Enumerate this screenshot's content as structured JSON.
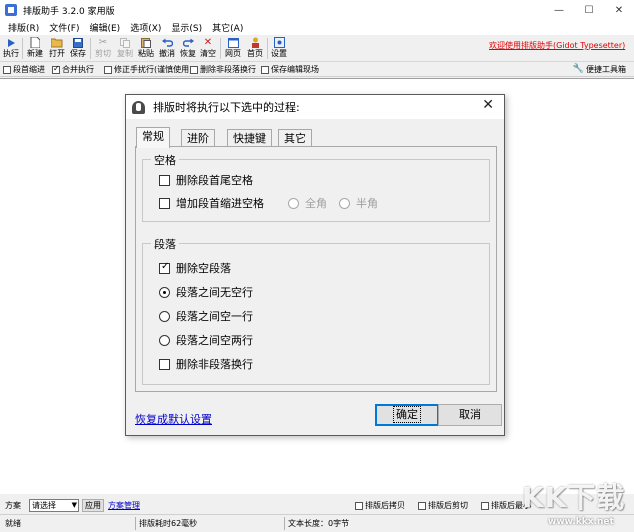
{
  "window": {
    "title": "排版助手 3.2.0 家用版",
    "minimize": "—",
    "maximize": "☐",
    "close": "✕"
  },
  "menu": [
    "排版(R)",
    "文件(F)",
    "编辑(E)",
    "选项(X)",
    "显示(S)",
    "其它(A)"
  ],
  "toolbar": {
    "buttons": [
      {
        "label": "执行",
        "icon": "play-icon"
      },
      {
        "label": "新建",
        "icon": "new-file-icon"
      },
      {
        "label": "打开",
        "icon": "open-folder-icon"
      },
      {
        "label": "保存",
        "icon": "save-icon"
      },
      {
        "label": "剪切",
        "icon": "cut-icon"
      },
      {
        "label": "复制",
        "icon": "copy-icon"
      },
      {
        "label": "粘贴",
        "icon": "paste-icon"
      },
      {
        "label": "撤消",
        "icon": "undo-icon"
      },
      {
        "label": "恢复",
        "icon": "redo-icon"
      },
      {
        "label": "清空",
        "icon": "clear-icon"
      },
      {
        "label": "网页",
        "icon": "webpage-icon"
      },
      {
        "label": "首页",
        "icon": "home-icon"
      },
      {
        "label": "设置",
        "icon": "settings-icon"
      }
    ],
    "welcome": "欢迎使用排版助手(Gidot Typesetter)"
  },
  "options": [
    {
      "label": "段首缩进",
      "checked": false
    },
    {
      "label": "合并执行",
      "checked": true
    },
    {
      "label": "修正手扰行(谨慎使用)",
      "checked": false
    },
    {
      "label": "删除非段落换行",
      "checked": false
    },
    {
      "label": "保存编辑现场",
      "checked": false
    }
  ],
  "quick_toolbox": "便捷工具箱",
  "scheme": {
    "label": "方案",
    "selected": "请选择",
    "apply": "应用",
    "manage": "方案管理",
    "post_options": [
      "排版后拷贝",
      "排版后剪切",
      "排版后最小"
    ]
  },
  "status": {
    "left": "就绪",
    "elapsed": "排版耗时62毫秒",
    "length": "文本长度：0字节"
  },
  "watermark": {
    "logo": "KK下载",
    "url": "www.kkx.net"
  },
  "dialog": {
    "title": "排版时将执行以下选中的过程:",
    "close": "✕",
    "tabs": [
      "常规",
      "进阶",
      "快捷键",
      "其它"
    ],
    "active_tab": "常规",
    "group_space": {
      "title": "空格",
      "delete_leading_trailing": {
        "label": "删除段首尾空格",
        "checked": false
      },
      "add_indent": {
        "label": "增加段首缩进空格",
        "checked": false
      },
      "fullwidth": "全角",
      "halfwidth": "半角"
    },
    "group_paragraph": {
      "title": "段落",
      "delete_empty": {
        "label": "删除空段落",
        "checked": true
      },
      "no_blank": {
        "label": "段落之间无空行",
        "checked": true
      },
      "one_blank": {
        "label": "段落之间空一行",
        "checked": false
      },
      "two_blank": {
        "label": "段落之间空两行",
        "checked": false
      },
      "delete_nonpara_break": {
        "label": "删除非段落换行",
        "checked": false
      }
    },
    "restore_defaults": "恢复成默认设置",
    "ok": "确定",
    "cancel": "取消"
  }
}
